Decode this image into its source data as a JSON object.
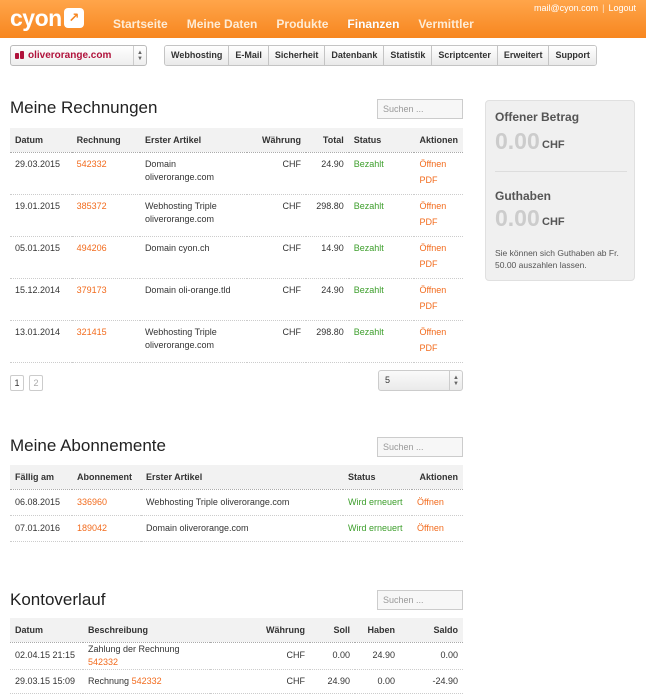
{
  "header": {
    "logo_text": "cyon",
    "logo_mark": "↗",
    "nav": [
      {
        "label": "Startseite",
        "active": false
      },
      {
        "label": "Meine Daten",
        "active": false
      },
      {
        "label": "Produkte",
        "active": false
      },
      {
        "label": "Finanzen",
        "active": true
      },
      {
        "label": "Vermittler",
        "active": false
      }
    ],
    "user_email": "mail@cyon.com",
    "logout_label": "Logout",
    "separator": "|"
  },
  "toolbar": {
    "domain_selected": "oliverorange.com",
    "buttons": [
      "Webhosting",
      "E-Mail",
      "Sicherheit",
      "Datenbank",
      "Statistik",
      "Scriptcenter",
      "Erweitert",
      "Support"
    ]
  },
  "invoices": {
    "title": "Meine Rechnungen",
    "search_placeholder": "Suchen ...",
    "columns": [
      "Datum",
      "Rechnung",
      "Erster Artikel",
      "Währung",
      "Total",
      "Status",
      "Aktionen"
    ],
    "rows": [
      {
        "date": "29.03.2015",
        "number": "542332",
        "item1": "Domain",
        "item2": "oliverorange.com",
        "currency": "CHF",
        "total": "24.90",
        "status": "Bezahlt",
        "action1": "Öffnen",
        "action2": "PDF"
      },
      {
        "date": "19.01.2015",
        "number": "385372",
        "item1": "Webhosting Triple",
        "item2": "oliverorange.com",
        "currency": "CHF",
        "total": "298.80",
        "status": "Bezahlt",
        "action1": "Öffnen",
        "action2": "PDF"
      },
      {
        "date": "05.01.2015",
        "number": "494206",
        "item1": "Domain cyon.ch",
        "item2": "",
        "currency": "CHF",
        "total": "14.90",
        "status": "Bezahlt",
        "action1": "Öffnen",
        "action2": "PDF"
      },
      {
        "date": "15.12.2014",
        "number": "379173",
        "item1": "Domain oli-orange.tld",
        "item2": "",
        "currency": "CHF",
        "total": "24.90",
        "status": "Bezahlt",
        "action1": "Öffnen",
        "action2": "PDF"
      },
      {
        "date": "13.01.2014",
        "number": "321415",
        "item1": "Webhosting Triple",
        "item2": "oliverorange.com",
        "currency": "CHF",
        "total": "298.80",
        "status": "Bezahlt",
        "action1": "Öffnen",
        "action2": "PDF"
      }
    ],
    "pages": [
      "1",
      "2"
    ],
    "per_page": "5"
  },
  "subscriptions": {
    "title": "Meine Abonnemente",
    "search_placeholder": "Suchen ...",
    "columns": [
      "Fällig am",
      "Abonnement",
      "Erster Artikel",
      "Status",
      "Aktionen"
    ],
    "rows": [
      {
        "date": "06.08.2015",
        "number": "336960",
        "item": "Webhosting Triple oliverorange.com",
        "status": "Wird erneuert",
        "action": "Öffnen"
      },
      {
        "date": "07.01.2016",
        "number": "189042",
        "item": "Domain oliverorange.com",
        "status": "Wird erneuert",
        "action": "Öffnen"
      }
    ]
  },
  "account": {
    "title": "Kontoverlauf",
    "search_placeholder": "Suchen ...",
    "columns": [
      "Datum",
      "Beschreibung",
      "Währung",
      "Soll",
      "Haben",
      "Saldo"
    ],
    "rows": [
      {
        "date": "02.04.15 21:15",
        "desc": "Zahlung der Rechnung",
        "ref": "542332",
        "currency": "CHF",
        "debit": "0.00",
        "credit": "24.90",
        "balance": "0.00"
      },
      {
        "date": "29.03.15 15:09",
        "desc": "Rechnung",
        "ref": "542332",
        "currency": "CHF",
        "debit": "24.90",
        "credit": "0.00",
        "balance": "-24.90"
      }
    ]
  },
  "sidebar": {
    "open_label": "Offener Betrag",
    "open_amount": "0.00",
    "open_currency": "CHF",
    "credit_label": "Guthaben",
    "credit_amount": "0.00",
    "credit_currency": "CHF",
    "note": "Sie können sich Guthaben ab Fr. 50.00 auszahlen lassen."
  },
  "colors": {
    "brand": "#f7861f",
    "link": "#f26b1d",
    "status_ok": "#3c9e2b",
    "domain": "#b0123b"
  }
}
